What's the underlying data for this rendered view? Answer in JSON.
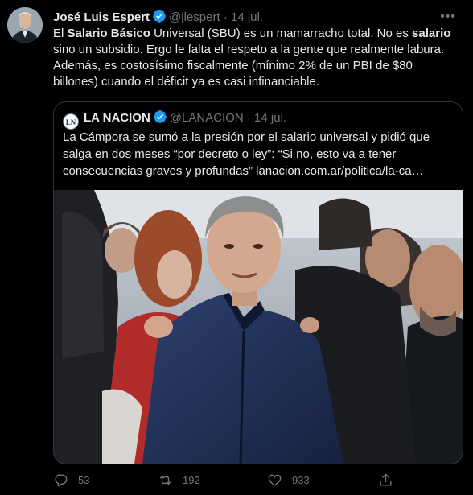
{
  "tweet": {
    "author_name": "José Luis Espert",
    "handle": "@jlespert",
    "separator": "·",
    "date": "14 jul.",
    "more_label": "•••",
    "text": {
      "p1": "El ",
      "b1": "Salario Básico",
      "p2": " Universal (SBU) es un mamarracho total. No es ",
      "b2": "salario",
      "p3": " sino un subsidio. Ergo le falta el respeto a la gente que realmente labura. Además, es costosísimo fiscalmente (mínimo 2% de un PBI de $80 billones) cuando el déficit ya es casi infinanciable."
    }
  },
  "quoted_tweet": {
    "logo_text": "LN",
    "author_name": "LA NACION",
    "handle": "@LANACION",
    "separator": "·",
    "date": "14 jul.",
    "text": "La Cámpora se sumó a la presión por el salario universal y pidió que salga en dos meses “por decreto o ley”: “Si no, esto va a tener consecuencias graves y profundas” lanacion.com.ar/politica/la-ca…"
  },
  "actions": {
    "reply_count": "53",
    "retweet_count": "192",
    "like_count": "933"
  },
  "icons": [
    "verified-badge-icon",
    "more-icon",
    "reply-icon",
    "retweet-icon",
    "like-icon",
    "share-icon"
  ],
  "colors": {
    "background": "#000000",
    "text": "#e7e9ea",
    "muted": "#71767b",
    "verified": "#1d9bf0",
    "border": "#2f3336"
  }
}
